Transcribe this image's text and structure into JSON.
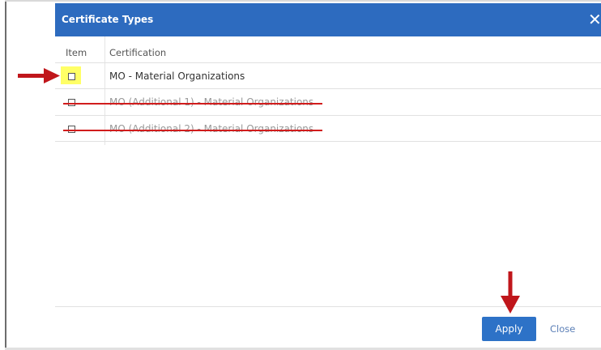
{
  "dialog": {
    "title": "Certificate Types",
    "close_glyph": "✕"
  },
  "table": {
    "headers": [
      "Item",
      "Certification"
    ],
    "rows": [
      {
        "label": "MO - Material Organizations",
        "checked": false,
        "highlighted": true,
        "struck": false
      },
      {
        "label": "MO (Additional 1) - Material Organizations",
        "checked": false,
        "highlighted": false,
        "struck": true
      },
      {
        "label": "MO (Additional 2) - Material Organizations",
        "checked": false,
        "highlighted": false,
        "struck": true
      }
    ]
  },
  "footer": {
    "apply_label": "Apply",
    "close_label": "Close"
  },
  "colors": {
    "header_bg": "#2d6bbf",
    "apply_bg": "#2d72c7",
    "highlight": "#ffff66",
    "annotation_red": "#c0161b"
  },
  "icons": {
    "close": "close-icon",
    "left_arrow": "annotation-arrow-right",
    "down_arrow": "annotation-arrow-down"
  }
}
